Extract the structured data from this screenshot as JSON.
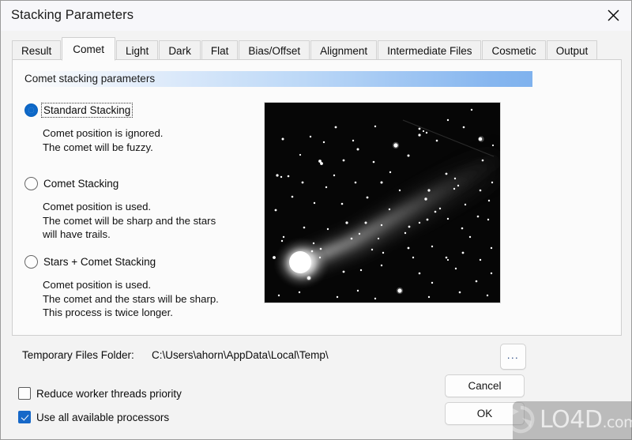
{
  "window": {
    "title": "Stacking Parameters",
    "close_icon": "close-icon"
  },
  "tabs": [
    {
      "label": "Result",
      "selected": false
    },
    {
      "label": "Comet",
      "selected": true
    },
    {
      "label": "Light",
      "selected": false
    },
    {
      "label": "Dark",
      "selected": false
    },
    {
      "label": "Flat",
      "selected": false
    },
    {
      "label": "Bias/Offset",
      "selected": false
    },
    {
      "label": "Alignment",
      "selected": false
    },
    {
      "label": "Intermediate Files",
      "selected": false
    },
    {
      "label": "Cosmetic",
      "selected": false
    },
    {
      "label": "Output",
      "selected": false
    }
  ],
  "group": {
    "header": "Comet stacking parameters",
    "gradient_start": "#fbfbfb",
    "gradient_end": "#7fb2ee"
  },
  "options": [
    {
      "label": "Standard Stacking",
      "selected": true,
      "focused": true,
      "description": "Comet position is ignored.\nThe comet will be fuzzy."
    },
    {
      "label": "Comet Stacking",
      "selected": false,
      "focused": false,
      "description": "Comet position is used.\nThe comet will be sharp and the stars\nwill have trails."
    },
    {
      "label": "Stars + Comet Stacking",
      "selected": false,
      "focused": false,
      "description": "Comet position is used.\nThe comet and the stars will be sharp.\nThis process is twice longer."
    }
  ],
  "preview": {
    "name": "comet-preview-image",
    "alt": "Photograph of a comet with a bright coma at lower left and a diffuse tail extending to the upper right across a star field",
    "background": "#050505"
  },
  "temp_folder": {
    "label": "Temporary Files Folder:",
    "value": "C:\\Users\\ahorn\\AppData\\Local\\Temp\\",
    "browse_label": "..."
  },
  "checkboxes": [
    {
      "label": "Reduce worker threads priority",
      "checked": false
    },
    {
      "label": "Use all available processors",
      "checked": true
    }
  ],
  "buttons": {
    "cancel": "Cancel",
    "ok": "OK"
  },
  "watermark": {
    "text": "LO4D",
    "suffix": ".com",
    "logo_icon": "refresh-circular-arrows-icon"
  }
}
